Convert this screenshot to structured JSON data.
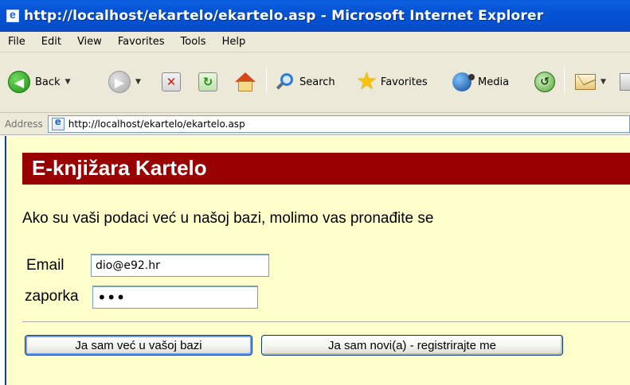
{
  "window": {
    "title": "http://localhost/ekartelo/ekartelo.asp - Microsoft Internet Explorer"
  },
  "menu": {
    "items": [
      "File",
      "Edit",
      "View",
      "Favorites",
      "Tools",
      "Help"
    ]
  },
  "toolbar": {
    "back_label": "Back",
    "search_label": "Search",
    "favorites_label": "Favorites",
    "media_label": "Media"
  },
  "address": {
    "label": "Address",
    "url": "http://localhost/ekartelo/ekartelo.asp"
  },
  "page": {
    "heading": "E-knjižara Kartelo",
    "intro": "Ako su vaši podaci već u našoj bazi, molimo vas pronađite se",
    "email_label": "Email",
    "email_value": "dio@e92.hr",
    "password_label": "zaporka",
    "password_mask": "•••",
    "existing_user_button": "Ja sam već u vašoj bazi",
    "register_button": "Ja sam novi(a) - registrirajte me"
  },
  "colors": {
    "heading_bg": "#990000",
    "page_bg": "#ffffcc",
    "titlebar": "#0655d6"
  }
}
